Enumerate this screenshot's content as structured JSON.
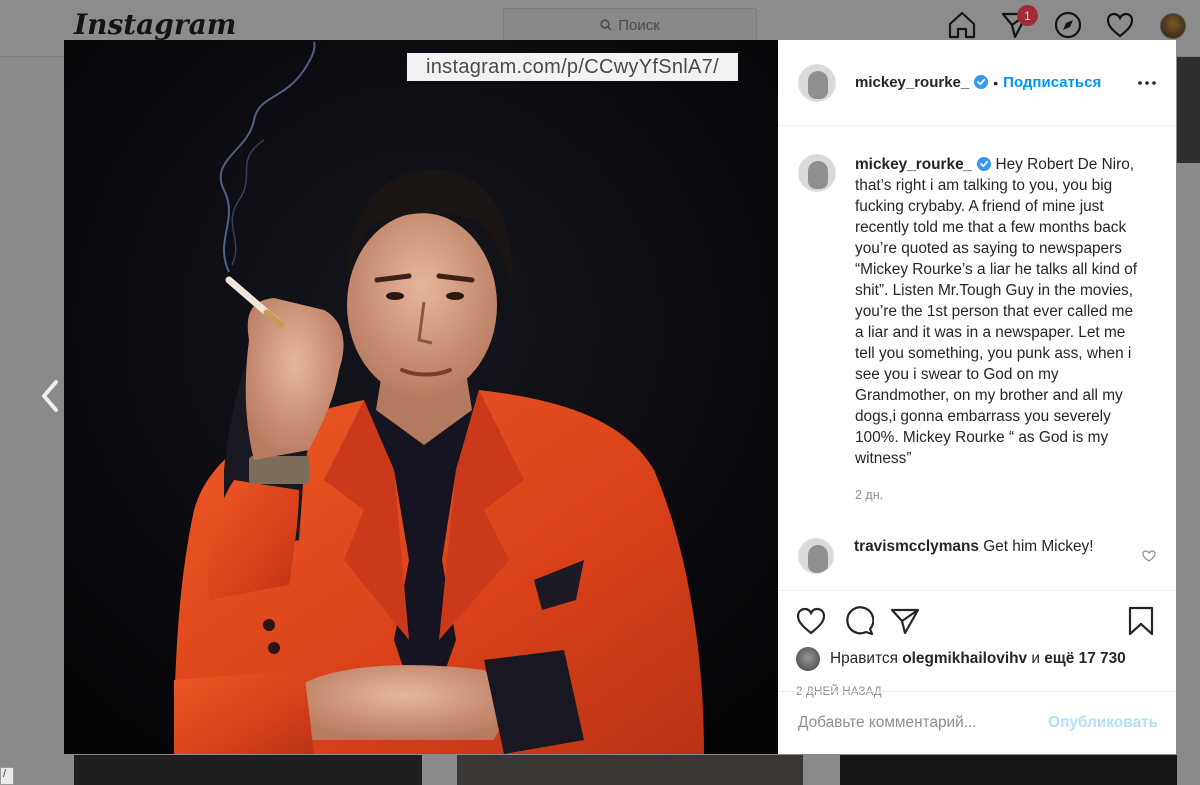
{
  "header": {
    "logo": "Instagram",
    "search_placeholder": "Поиск",
    "notification_count": "1"
  },
  "photo_overlay": {
    "url_text": "instagram.com/p/CCwyYfSnlA7/"
  },
  "post": {
    "author": "mickey_rourke_",
    "separator": "•",
    "follow_label": "Подписаться",
    "caption": "Hey Robert De Niro, that’s right i am talking to you, you big fucking crybaby. A friend of mine just recently told me that a few months back you’re quoted as saying to newspapers “Mickey Rourke’s a liar he talks all kind of shit”. Listen Mr.Tough Guy in the movies, you’re the 1st person that ever called me a liar and it was in a newspaper. Let me tell you something, you punk ass, when i see you i swear to God on my Grandmother, on my brother and all my dogs,i gonna embarrass you severely 100%. Mickey Rourke “ as God is my witness”",
    "caption_age": "2 дн.",
    "comments": [
      {
        "user": "travismcclymans",
        "text": "Get him Mickey!"
      }
    ],
    "likes": {
      "prefix": "Нравится",
      "user": "olegmikhailovihv",
      "conjunction": "и",
      "count": "ещё 17 730"
    },
    "posted_ago": "2 дней назад",
    "comment_placeholder": "Добавьте комментарий...",
    "publish_label": "Опубликовать"
  },
  "colors": {
    "accent": "#0095f6",
    "publish_disabled": "#b2dffc",
    "jacket": "#e0441a",
    "badge": "#a02c38"
  },
  "icons": [
    "home-icon",
    "direct-icon",
    "explore-icon",
    "activity-icon",
    "heart-icon",
    "comment-icon",
    "share-icon",
    "bookmark-icon",
    "more-icon",
    "verified-icon",
    "chevron-left-icon"
  ]
}
